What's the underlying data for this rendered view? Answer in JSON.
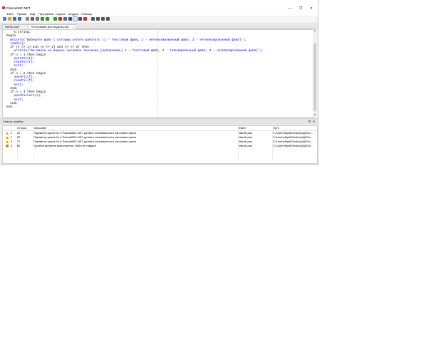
{
  "window": {
    "title": "PascalABC.NET",
    "controls": {
      "minimize": "—",
      "restore": "❐",
      "close": "✕"
    }
  },
  "menu": [
    "Файл",
    "Правка",
    "Вид",
    "Программа",
    "Сервис",
    "Модули",
    "Помощь"
  ],
  "toolbar": {
    "icons": [
      "new-file-icon",
      "open-icon",
      "save-icon",
      "save-all-icon",
      "cut-icon",
      "copy-icon",
      "paste-icon",
      "undo-icon",
      "redo-icon",
      "run-icon",
      "stop-icon",
      "debug-icon",
      "step-icon",
      "step-into-icon",
      "step-out-icon",
      "breakpoint-icon",
      "format-icon",
      "find-icon",
      "zoom-in-icon",
      "zoom-out-icon"
    ],
    "selected_index": 13
  },
  "tabs": [
    {
      "label": "Narvik.pas*",
      "active": false
    },
    {
      "label": "*Программа для модуля.pas*",
      "active": true
    }
  ],
  "editor": {
    "lines": [
      "    s:string;",
      "begin",
      "  writeln('Выберите файл с которым хотите работать (1 - текстовый файл, 2 - нетипизированный файл, 3 - нетипизированный файл)');",
      "  read(n);",
      "  if (n <> 1) and (n <> 2) and (n <> 3) then",
      "    writeln('Вы ввели не верное числовое значение (выповниаль) 1 - текстовый файл, 2 - типизированный файл, 3 - нетипизированный файл)')",
      "  if n = 1 then begin",
      "    openTxt(t);",
      "    readTxt(t);",
      "    exit;",
      "  end;",
      "  if n = 2 then begin",
      "    openFil(f);",
      "    readFil(f);",
      "    exit;",
      "  end;",
      "  if n = 3 then begin",
      "    openPicture(x);",
      "    exit;",
      "  end;",
      "end."
    ]
  },
  "error_panel": {
    "title": "Список ошибок",
    "pin": "⊟",
    "close": "✕",
    "columns": [
      "",
      "Строка",
      "Описание",
      "Файл",
      "Путь"
    ],
    "rows": [
      {
        "icon": "warning-icon",
        "n": "1",
        "line": "21",
        "desc": "Параметр цикла for в PascalABC.NET должен описываться в заголовке цикла",
        "file": "Narvik.pas",
        "path": "C:\\Users\\Mydi\\Desktop\\ДЗ\\Ос..."
      },
      {
        "icon": "warning-icon",
        "n": "2",
        "line": "55",
        "desc": "Параметр цикла for в PascalABC.NET должен описываться в заголовке цикла",
        "file": "Narvik.pas",
        "path": "C:\\Users\\Mydi\\Desktop\\ДЗ\\Ос..."
      },
      {
        "icon": "warning-icon",
        "n": "3",
        "line": "72",
        "desc": "Параметр цикла for в PascalABC.NET должен описываться в заголовке цикла",
        "file": "Narvik.pas",
        "path": "C:\\Users\\Mydi\\Desktop\\ДЗ\\Ос..."
      },
      {
        "icon": "runtime-error-icon",
        "n": "4",
        "line": "86",
        "desc": "Ошибка времени выполнения: Файл  не найден",
        "file": "Narvik.pas",
        "path": "C:\\Users\\Mydi\\Desktop\\ДЗ\\Ос..."
      }
    ]
  },
  "colors": {
    "keyword": "#000000",
    "identifier": "#0000cc",
    "accent": "#7aa7d6"
  }
}
